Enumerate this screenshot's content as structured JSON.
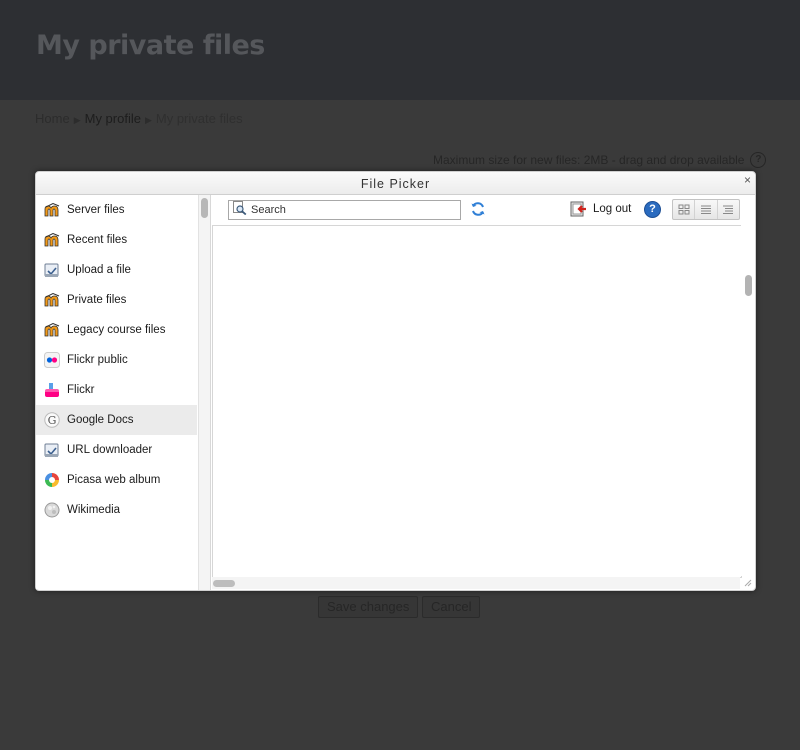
{
  "page": {
    "title": "My private files",
    "breadcrumb": [
      "Home",
      "My profile",
      "My private files"
    ],
    "max_size_note": "Maximum size for new files: 2MB - drag and drop available",
    "help_glyph": "?",
    "buttons": {
      "save": "Save changes",
      "cancel": "Cancel"
    }
  },
  "dialog": {
    "title": "File Picker",
    "close_glyph": "×",
    "repositories": [
      {
        "label": "Server files",
        "icon": "moodle-icon"
      },
      {
        "label": "Recent files",
        "icon": "moodle-icon"
      },
      {
        "label": "Upload a file",
        "icon": "upload-icon"
      },
      {
        "label": "Private files",
        "icon": "moodle-icon"
      },
      {
        "label": "Legacy course files",
        "icon": "moodle-icon"
      },
      {
        "label": "Flickr public",
        "icon": "flickr-public-icon"
      },
      {
        "label": "Flickr",
        "icon": "flickr-icon"
      },
      {
        "label": "Google Docs",
        "icon": "google-docs-icon",
        "active": true
      },
      {
        "label": "URL downloader",
        "icon": "url-downloader-icon"
      },
      {
        "label": "Picasa web album",
        "icon": "picasa-icon"
      },
      {
        "label": "Wikimedia",
        "icon": "wikimedia-icon"
      }
    ],
    "toolbar": {
      "search_placeholder": "Search",
      "logout_label": "Log out",
      "help_glyph": "?",
      "views": [
        "icon-view",
        "list-view",
        "tree-view"
      ]
    }
  },
  "colors": {
    "overlay_bg": "#3a3a3a",
    "header_bg": "#2d2f33",
    "active_item_bg": "#ebebeb",
    "help_blue": "#2a6bbf"
  }
}
